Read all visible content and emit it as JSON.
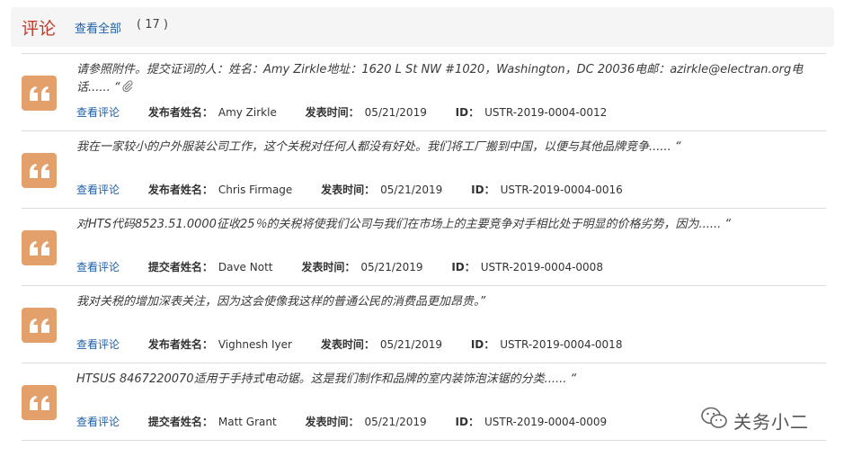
{
  "header": {
    "title": "评论",
    "view_all": "查看全部",
    "count": "( 17 )"
  },
  "labels": {
    "view_comment": "查看评论",
    "posted_time": "发表时间：",
    "id": "ID："
  },
  "comments": [
    {
      "text": "请参照附件。提交证词的人：姓名：Amy Zirkle地址：1620 L St NW #1020，Washington，DC 20036电邮：azirkle@electran.org电话...... “",
      "has_attachment": true,
      "poster_label": "发布者姓名：",
      "poster": "Amy Zirkle",
      "date": "05/21/2019",
      "id": "USTR-2019-0004-0012"
    },
    {
      "text": "我在一家较小的户外服装公司工作，这个关税对任何人都没有好处。我们将工厂搬到中国，以便与其他品牌竞争...... “",
      "has_attachment": false,
      "poster_label": "发布者姓名：",
      "poster": "Chris Firmage",
      "date": "05/21/2019",
      "id": "USTR-2019-0004-0016"
    },
    {
      "text": "对HTS代码8523.51.0000征收25％的关税将使我们公司与我们在市场上的主要竞争对手相比处于明显的价格劣势，因为...... “",
      "has_attachment": false,
      "poster_label": "提交者姓名：",
      "poster": "Dave Nott",
      "date": "05/21/2019",
      "id": "USTR-2019-0004-0008"
    },
    {
      "text": "我对关税的增加深表关注，因为这会使像我这样的普通公民的消费品更加昂贵。”",
      "has_attachment": false,
      "poster_label": "发布者姓名：",
      "poster": "Vighnesh Iyer",
      "date": "05/21/2019",
      "id": "USTR-2019-0004-0018"
    },
    {
      "text": "HTSUS 8467220070适用于手持式电动锯。这是我们制作和品牌的室内装饰泡沫锯的分类...... “",
      "has_attachment": false,
      "poster_label": "提交者姓名：",
      "poster": "Matt Grant",
      "date": "05/21/2019",
      "id": "USTR-2019-0004-0009"
    }
  ],
  "watermark": "关务小二",
  "colors": {
    "title_red": "#c0392b",
    "link_blue": "#1f5fa5",
    "badge_orange": "#e3a06a",
    "header_bg": "#f5f5f5"
  }
}
